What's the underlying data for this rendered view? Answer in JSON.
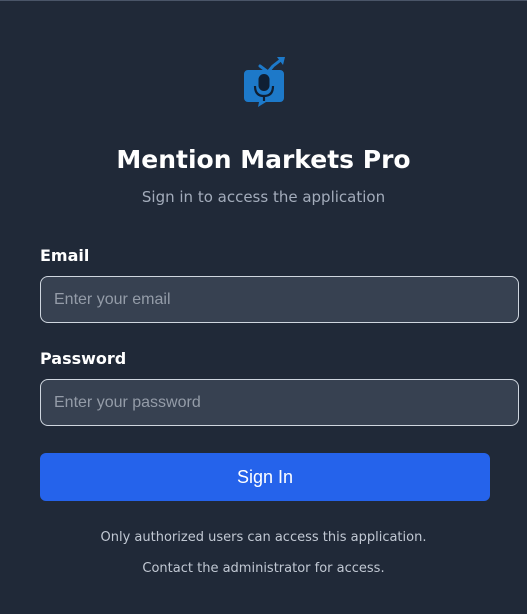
{
  "app": {
    "title": "Mention Markets Pro",
    "subtitle": "Sign in to access the application",
    "logo_icon": "microphone-chat-trend-icon"
  },
  "form": {
    "email": {
      "label": "Email",
      "value": "",
      "placeholder": "Enter your email"
    },
    "password": {
      "label": "Password",
      "value": "",
      "placeholder": "Enter your password"
    },
    "submit_label": "Sign In"
  },
  "footer": {
    "note": "Only authorized users can access this application.",
    "contact": "Contact the administrator for access."
  },
  "colors": {
    "background": "#202938",
    "input_background": "#374151",
    "accent": "#2563eb",
    "logo_blue": "#1d79c9"
  }
}
